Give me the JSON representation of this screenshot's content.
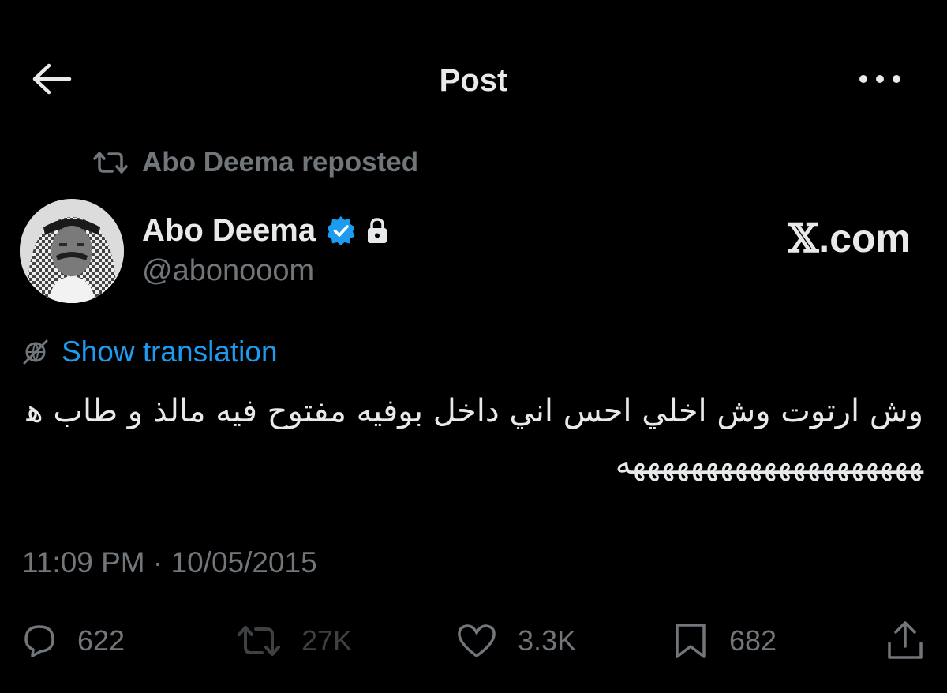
{
  "header": {
    "title": "Post",
    "back_icon": "arrow-left-icon",
    "more_icon": "more-horizontal-icon"
  },
  "repost_context": {
    "text": "Abo Deema reposted",
    "icon": "repost-icon"
  },
  "author": {
    "name": "Abo Deema",
    "handle": "@abonooom",
    "verified": true,
    "protected": true,
    "avatar_icon": "avatar-photo"
  },
  "watermark": {
    "x_letter": "𝕏",
    "suffix": ".com"
  },
  "translation": {
    "label": "Show translation",
    "icon": "translate-globe-icon"
  },
  "tweet": {
    "text": "وش ارتوت وش اخلي احس اني داخل بوفيه مفتوح فيه مالذ و طاب هههههههههههههههههههههه"
  },
  "meta": {
    "timestamp": "11:09 PM · 10/05/2015"
  },
  "actions": {
    "replies": "622",
    "reposts": "27K",
    "likes": "3.3K",
    "bookmarks": "682"
  },
  "colors": {
    "background": "#000000",
    "text": "#e7e9ea",
    "secondary": "#71767b",
    "accent": "#1d9bf0"
  }
}
